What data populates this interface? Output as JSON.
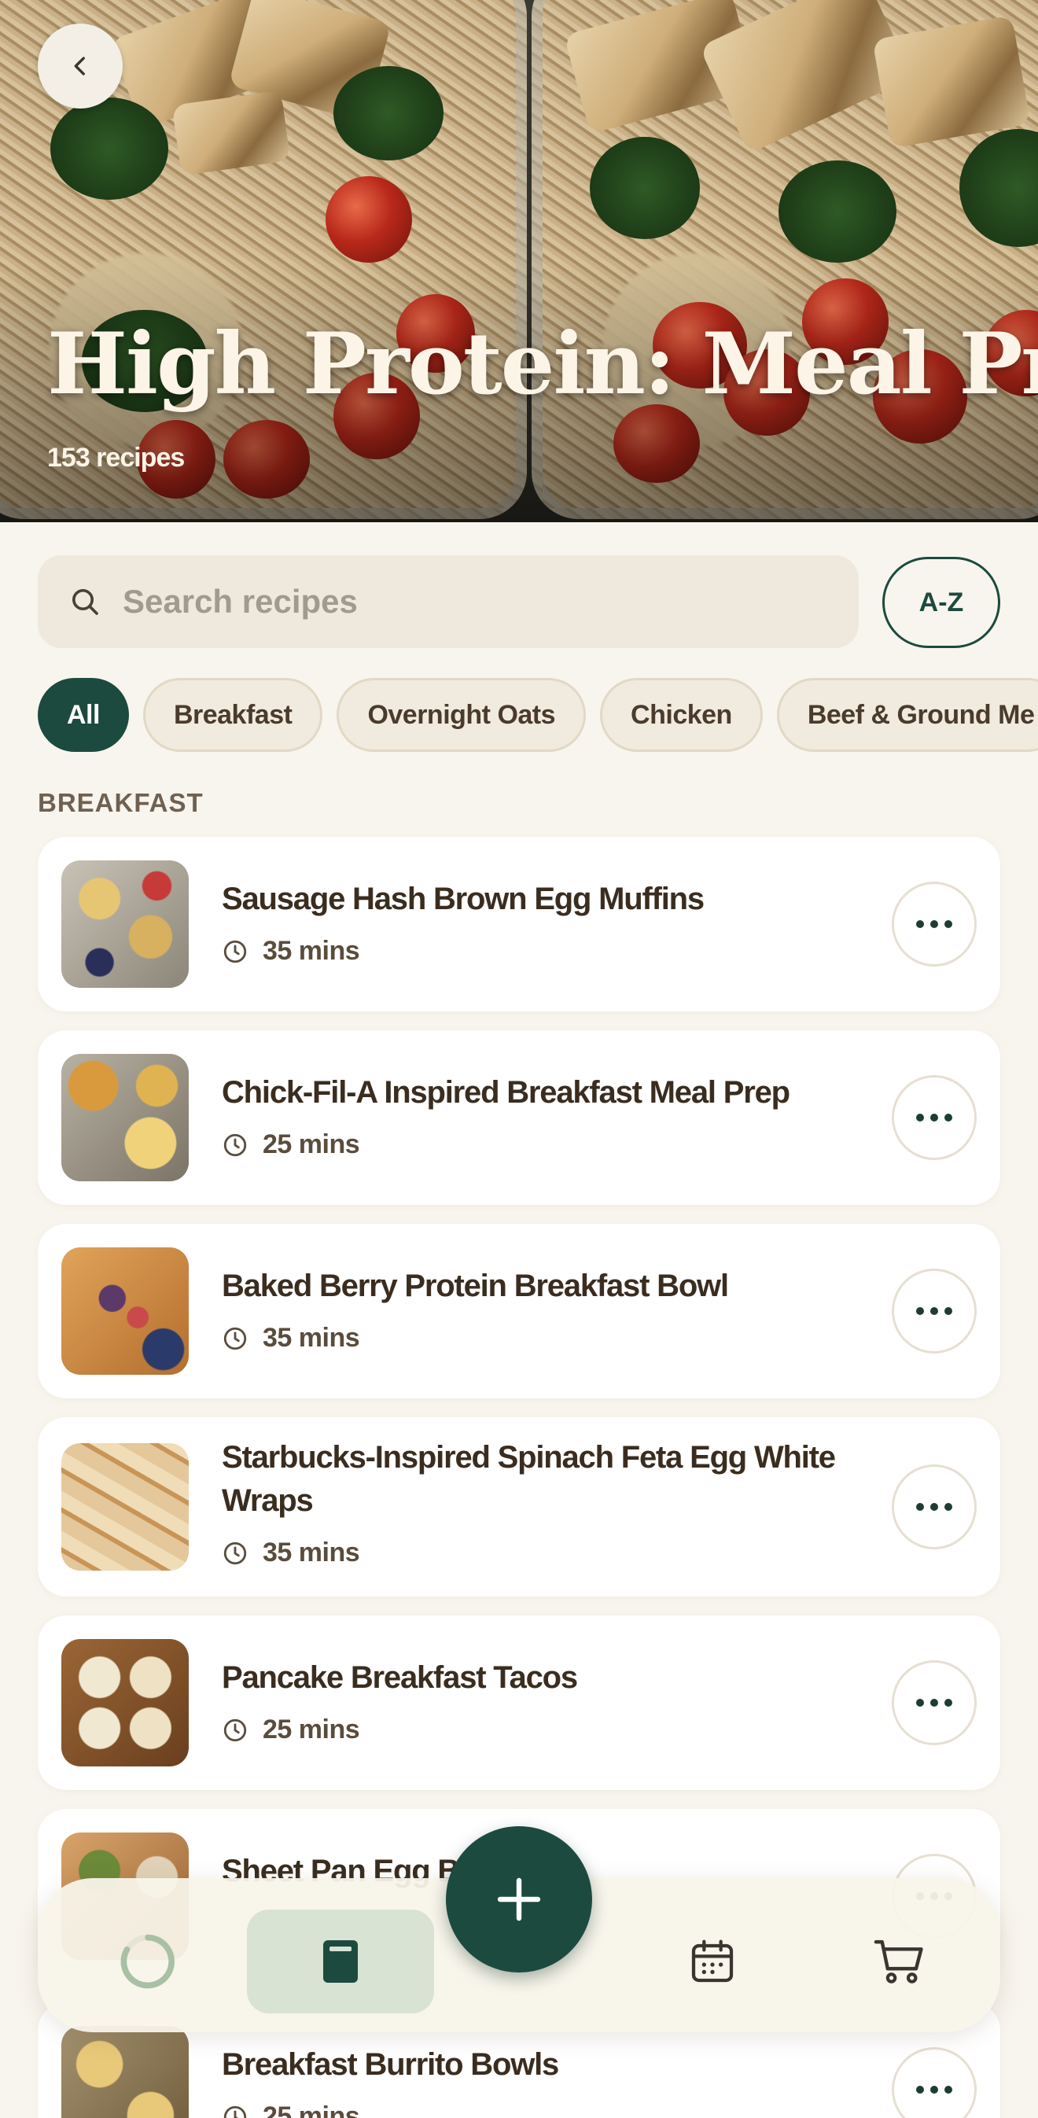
{
  "hero": {
    "title": "High Protein: Meal Prep",
    "recipe_count": "153 recipes"
  },
  "search": {
    "placeholder": "Search recipes",
    "value": "",
    "sort_label": "A-Z"
  },
  "filters": [
    {
      "label": "All",
      "active": true
    },
    {
      "label": "Breakfast",
      "active": false
    },
    {
      "label": "Overnight Oats",
      "active": false
    },
    {
      "label": "Chicken",
      "active": false
    },
    {
      "label": "Beef & Ground Me",
      "active": false
    }
  ],
  "section": {
    "label": "BREAKFAST"
  },
  "recipes": [
    {
      "title": "Sausage Hash Brown Egg Muffins",
      "time": "35 mins"
    },
    {
      "title": "Chick-Fil-A Inspired Breakfast Meal Prep",
      "time": "25 mins"
    },
    {
      "title": "Baked Berry Protein Breakfast Bowl",
      "time": "35 mins"
    },
    {
      "title": "Starbucks-Inspired Spinach Feta Egg White Wraps",
      "time": "35 mins"
    },
    {
      "title": "Pancake Breakfast Tacos",
      "time": "25 mins"
    },
    {
      "title": "Sheet Pan Egg B",
      "time": ""
    },
    {
      "title": "Breakfast Burrito Bowls",
      "time": "25 mins"
    }
  ],
  "nav": {
    "items": [
      {
        "icon": "loading-spinner-icon",
        "active": false
      },
      {
        "icon": "recipe-book-icon",
        "active": true
      },
      {
        "icon": "add-icon",
        "active": false
      },
      {
        "icon": "calendar-icon",
        "active": false
      },
      {
        "icon": "cart-icon",
        "active": false
      }
    ]
  },
  "colors": {
    "accent": "#1d4a3f",
    "background": "#f8f5ee",
    "active_tab_bg": "#d8e3d3"
  }
}
